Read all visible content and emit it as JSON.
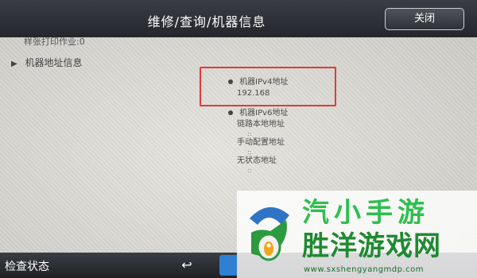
{
  "header": {
    "title": "维修/查询/机器信息",
    "close_label": "关闭"
  },
  "content": {
    "stub_text": "样张打印作业:0",
    "section_label": "机器地址信息",
    "ipv4": {
      "label": "机器IPv4地址",
      "value": "192.168"
    },
    "ipv6": {
      "label": "机器IPv6地址",
      "link_local": "链路本地地址",
      "manual": "手动配置地址",
      "stateless": "无状态地址",
      "dots": "::"
    }
  },
  "footer": {
    "label": "检查状态",
    "back_icon": "back-arrow-icon"
  },
  "watermark": {
    "title": "胜洋游戏网",
    "url": "www.sxshengyangmdp.com",
    "top_text": "汽小手游"
  },
  "colors": {
    "highlight": "#e03a3a",
    "header_bg": "#2b2d32",
    "accent_blue": "#2f7fd3",
    "watermark_green": "#1f8a2f"
  }
}
